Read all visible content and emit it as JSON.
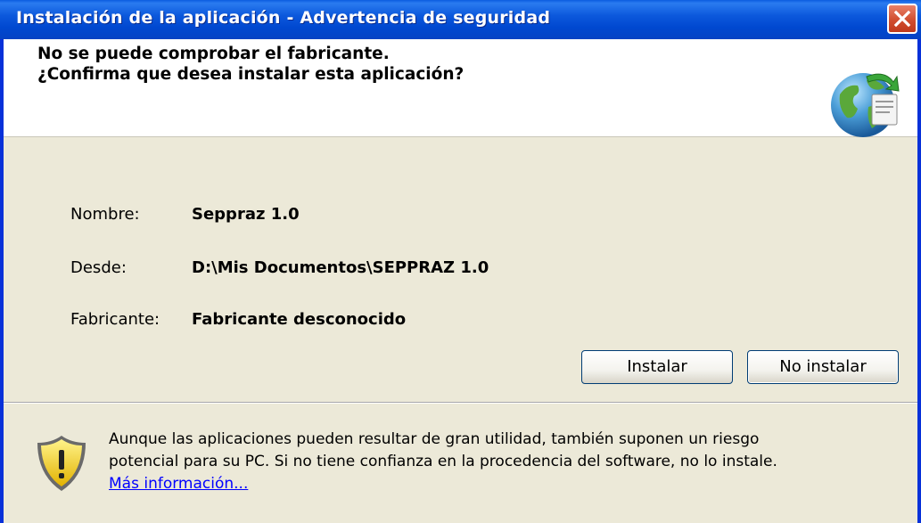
{
  "window": {
    "title": "Instalación de la aplicación - Advertencia de seguridad"
  },
  "header": {
    "line1": "No se puede comprobar el fabricante.",
    "line2": "¿Confirma que desea instalar esta aplicación?"
  },
  "details": {
    "name_label": "Nombre:",
    "name_value": "Seppraz 1.0",
    "from_label": "Desde:",
    "from_value": "D:\\Mis Documentos\\SEPPRAZ 1.0",
    "publisher_label": "Fabricante:",
    "publisher_value": "Fabricante desconocido"
  },
  "buttons": {
    "install": "Instalar",
    "dont_install": "No instalar"
  },
  "warning": {
    "line1": "Aunque las aplicaciones pueden resultar de gran utilidad, también suponen un riesgo",
    "line2": "potencial para su PC. Si no tiene confianza en la procedencia del software, no lo instale.",
    "link": "Más información..."
  },
  "icons": {
    "close": "close-icon",
    "app": "globe-install-icon",
    "warning": "security-shield-icon"
  },
  "colors": {
    "titlebar": "#0054e3",
    "dialog_bg": "#ece9d8",
    "header_bg": "#ffffff",
    "link": "#0000ff",
    "close_button": "#d14e2f"
  }
}
